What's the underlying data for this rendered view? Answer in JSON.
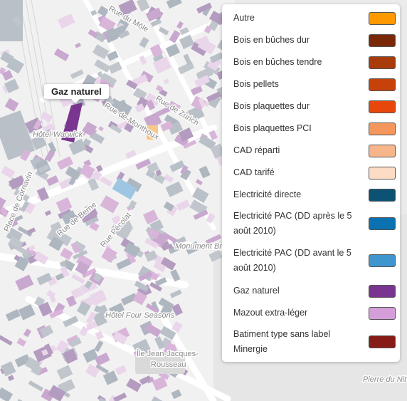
{
  "tooltip": "Gaz naturel",
  "map_labels": {
    "rue_du_mole": "Rue du Môle",
    "rue_de_zurich": "Rue de Zurich",
    "rue_de_monthoux": "Rue de-Monthoux",
    "hotel_warwick": "Hôtel Warwick",
    "place_de_cornavin": "Place de Cornavin",
    "rue_de_berne": "Rue de Berne",
    "rue_pecolat": "Rue Pécolat",
    "monument": "Monument Bru",
    "hotel_four_seasons": "Hôtel Four Seasons",
    "ile_line1": "Île Jean-Jacques-",
    "ile_line2": "Rousseau",
    "pierre_du_niton": "Pierre du Nit"
  },
  "legend": [
    {
      "label": "Autre",
      "color": "#FF9900"
    },
    {
      "label": "Bois en bûches dur",
      "color": "#7A2808"
    },
    {
      "label": "Bois en bûches tendre",
      "color": "#A93A0A"
    },
    {
      "label": "Bois pellets",
      "color": "#C7420A"
    },
    {
      "label": "Bois plaquettes dur",
      "color": "#E8470B"
    },
    {
      "label": "Bois plaquettes PCI",
      "color": "#F5975D"
    },
    {
      "label": "CAD réparti",
      "color": "#F7B58A"
    },
    {
      "label": "CAD tarifé",
      "color": "#FDDCC6"
    },
    {
      "label": "Electricité directe",
      "color": "#0B5273"
    },
    {
      "label": "Electricité PAC (DD après le 5 août 2010)",
      "color": "#0A72B0"
    },
    {
      "label": "Electricité PAC (DD avant le 5 août 2010)",
      "color": "#3F96CF"
    },
    {
      "label": "Gaz naturel",
      "color": "#7A3590"
    },
    {
      "label": "Mazout extra-léger",
      "color": "#D49ED9"
    },
    {
      "label": "Batiment type sans label Minergie",
      "color": "#871B16"
    }
  ]
}
